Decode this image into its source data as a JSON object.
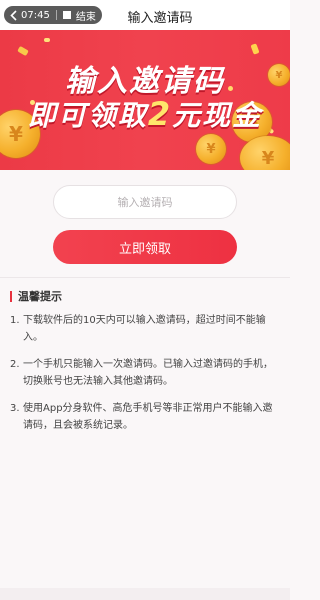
{
  "status": {
    "time": "07:45",
    "end_label": "结束"
  },
  "header": {
    "title": "输入邀请码"
  },
  "banner": {
    "line1": "输入邀请码",
    "line2_prefix": "即可领取",
    "line2_amount": "2",
    "line2_suffix": "元现金"
  },
  "form": {
    "code_placeholder": "输入邀请码",
    "submit_label": "立即领取"
  },
  "tips": {
    "heading": "温馨提示",
    "items": [
      {
        "num": "1.",
        "text": "下载软件后的10天内可以输入邀请码，超过时间不能输入。"
      },
      {
        "num": "2.",
        "text": "一个手机只能输入一次邀请码。已输入过邀请码的手机，切换账号也无法输入其他邀请码。"
      },
      {
        "num": "3.",
        "text": "使用App分身软件、高危手机号等非正常用户不能输入邀请码，且会被系统记录。"
      }
    ]
  },
  "colors": {
    "primary": "#ee3a47",
    "accent_gold": "#ffe56b"
  }
}
